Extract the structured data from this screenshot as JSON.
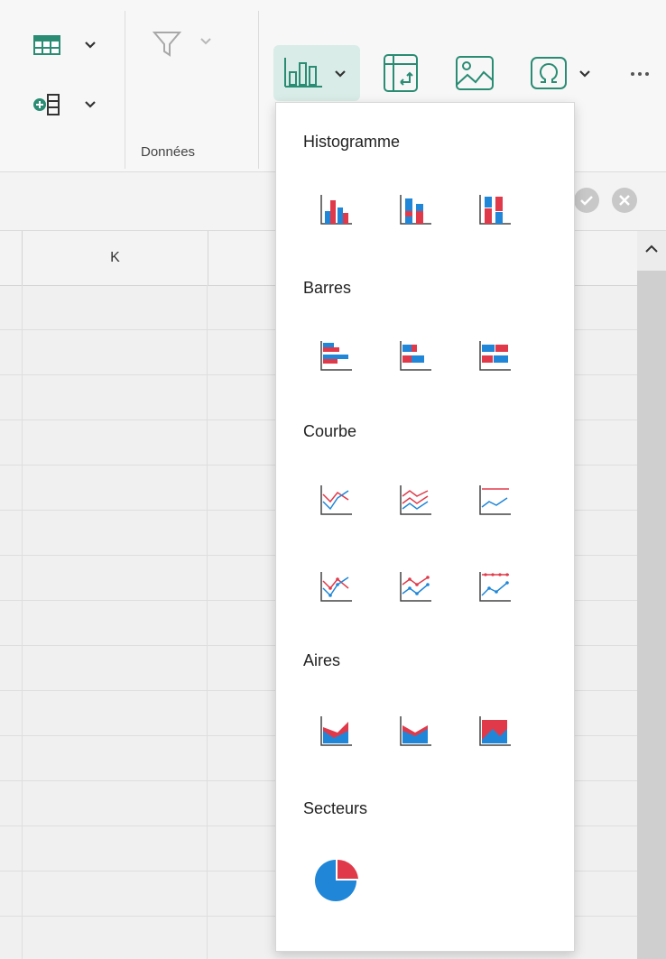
{
  "ribbon": {
    "group_donnees_label": "Données",
    "icons": {
      "table": "table-icon",
      "insert_cells": "insert-cells-icon",
      "filter": "filter-icon",
      "chart": "bar-chart-icon",
      "pivot": "pivot-table-icon",
      "image": "image-icon",
      "symbol": "omega-icon",
      "more": "ellipsis-icon"
    }
  },
  "grid": {
    "column_header": "K"
  },
  "chart_menu": {
    "sections": [
      {
        "title": "Histogramme",
        "items": [
          "clustered-column-icon",
          "stacked-column-icon",
          "percent-stacked-column-icon"
        ]
      },
      {
        "title": "Barres",
        "items": [
          "clustered-bar-icon",
          "stacked-bar-icon",
          "percent-stacked-bar-icon"
        ]
      },
      {
        "title": "Courbe",
        "items": [
          "line-icon",
          "stacked-line-icon",
          "percent-stacked-line-icon",
          "line-markers-icon",
          "stacked-line-markers-icon",
          "percent-stacked-line-markers-icon"
        ]
      },
      {
        "title": "Aires",
        "items": [
          "area-icon",
          "stacked-area-icon",
          "percent-stacked-area-icon"
        ]
      },
      {
        "title": "Secteurs",
        "items": [
          "pie-icon"
        ]
      }
    ]
  },
  "colors": {
    "accent": "#2a8c73",
    "chart_red": "#e03a4a",
    "chart_blue": "#1f86d8",
    "chart_button_bg": "#d9ece7"
  }
}
